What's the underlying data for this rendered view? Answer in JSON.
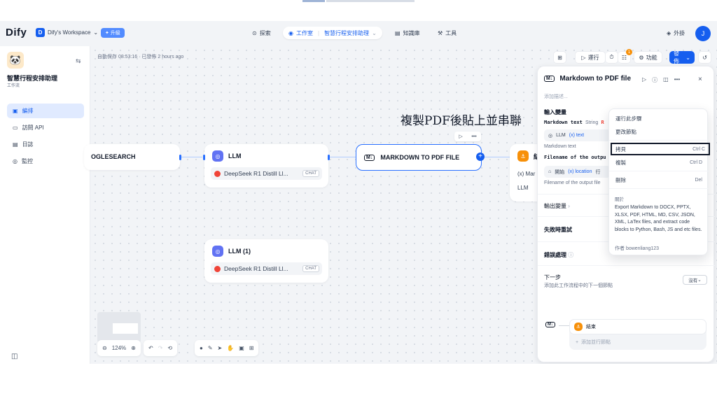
{
  "header": {
    "logo": "Dify",
    "workspace_initial": "D",
    "workspace": "Dify's Workspace",
    "upgrade": "升級",
    "nav": [
      {
        "label": "探索"
      },
      {
        "label": "工作室",
        "app": "智慧行程安排助理"
      },
      {
        "label": "知識庫"
      },
      {
        "label": "工具"
      }
    ],
    "plugins": "外掛",
    "avatar": "J"
  },
  "sidebar": {
    "app_name": "智慧行程安排助理",
    "app_type": "工作流",
    "items": [
      {
        "label": "編排",
        "icon": "orchestrate-icon"
      },
      {
        "label": "訪問 API",
        "icon": "api-icon"
      },
      {
        "label": "日誌",
        "icon": "logs-icon"
      },
      {
        "label": "監控",
        "icon": "monitor-icon"
      }
    ]
  },
  "canvas": {
    "autosave": "自動保存 08:53:16 · 已發佈 2 hours ago",
    "toolbar": {
      "run": "運行",
      "badge": "1",
      "features": "功能",
      "publish": "發佈"
    },
    "caption": "複製PDF後貼上並串聯",
    "nodes": {
      "search": "OGLESEARCH",
      "llm": {
        "title": "LLM",
        "model": "DeepSeek R1 Distill Ll...",
        "tag": "CHAT"
      },
      "llm1": {
        "title": "LLM (1)",
        "model": "DeepSeek R1 Distill Ll...",
        "tag": "CHAT"
      },
      "markdown": "MARKDOWN TO PDF FILE",
      "end_partial": {
        "title": "結",
        "row1": "(x) Mar",
        "row2": "LLM"
      }
    },
    "zoom": "124%"
  },
  "panel": {
    "title": "Markdown to PDF file",
    "desc_placeholder": "添加描述...",
    "input_vars": "輸入變量",
    "markdown_text": {
      "name": "Markdown text",
      "type": "String",
      "required": "R",
      "source": "LLM",
      "var": "(x) text",
      "desc": "Markdown text"
    },
    "filename": {
      "name": "Filename of the outpu",
      "source": "開始",
      "var": "(x) location",
      "extra": "行",
      "desc": "Filename of the output file"
    },
    "output_vars": "輸出變量",
    "retry": "失敗時重試",
    "error_handling": "錯誤處理",
    "error_value": "沒有",
    "next_step": "下一步",
    "next_desc": "添加此工作流程中的下一個節點",
    "next_node": "結束",
    "add_parallel": "添加並行節點"
  },
  "menu": {
    "items": [
      {
        "label": "運行此步驟",
        "key": ""
      },
      {
        "label": "更改節點",
        "key": ""
      },
      {
        "label": "拷貝",
        "key": "Ctrl C"
      },
      {
        "label": "複製",
        "key": "Ctrl D"
      },
      {
        "label": "刪除",
        "key": "Del"
      }
    ],
    "about_heading": "關於",
    "about": "Export Markdown to DOCX, PPTX, XLSX, PDF, HTML, MD, CSV, JSON, XML, LaTex files, and extract code blocks to Python, Bash, JS and etc files.",
    "author": "作者 bowenliang123"
  },
  "colors": {
    "accent": "#155eef",
    "node_border": "#2970ff",
    "llm_icon": "#6172f3",
    "end_icon": "#f79009"
  }
}
